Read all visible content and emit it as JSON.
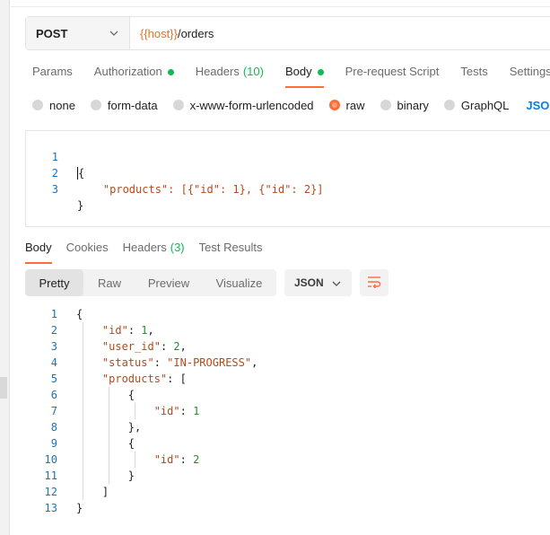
{
  "request": {
    "method": "POST",
    "url_variable": "{{host}}",
    "url_path": "/orders"
  },
  "request_tabs": [
    {
      "label": "Params",
      "active": false
    },
    {
      "label": "Authorization",
      "active": false,
      "dot": true
    },
    {
      "label": "Headers",
      "count": "(10)",
      "active": false
    },
    {
      "label": "Body",
      "active": true,
      "dot": true
    },
    {
      "label": "Pre-request Script",
      "active": false
    },
    {
      "label": "Tests",
      "active": false
    },
    {
      "label": "Settings",
      "active": false
    }
  ],
  "body_types": {
    "options": [
      "none",
      "form-data",
      "x-www-form-urlencoded",
      "raw",
      "binary",
      "GraphQL"
    ],
    "selected": "raw",
    "format": "JSON"
  },
  "request_body": {
    "line_numbers": [
      "1",
      "2",
      "3"
    ],
    "lines": [
      "{",
      "    \"products\": [{\"id\": 1}, {\"id\": 2}]",
      "}"
    ]
  },
  "response_tabs": [
    {
      "label": "Body",
      "active": true
    },
    {
      "label": "Cookies",
      "active": false
    },
    {
      "label": "Headers",
      "count": "(3)",
      "active": false
    },
    {
      "label": "Test Results",
      "active": false
    }
  ],
  "response_views": {
    "options": [
      "Pretty",
      "Raw",
      "Preview",
      "Visualize"
    ],
    "selected": "Pretty",
    "format": "JSON"
  },
  "response_body": {
    "line_numbers": [
      "1",
      "2",
      "3",
      "4",
      "5",
      "6",
      "7",
      "8",
      "9",
      "10",
      "11",
      "12",
      "13"
    ],
    "lines": [
      "{",
      "    \"id\": 1,",
      "    \"user_id\": 2,",
      "    \"status\": \"IN-PROGRESS\",",
      "    \"products\": [",
      "        {",
      "            \"id\": 1",
      "        },",
      "        {",
      "            \"id\": 2",
      "        }",
      "    ]",
      "}"
    ]
  },
  "colors": {
    "accent": "#ff6c37",
    "status_dot": "#0cbb52",
    "json_link": "#097bed",
    "url_variable": "#e8702a"
  },
  "icons": {
    "method_dropdown": "chevron-down-icon",
    "format_dropdown": "chevron-down-icon",
    "wrap": "wrap-lines-icon"
  }
}
